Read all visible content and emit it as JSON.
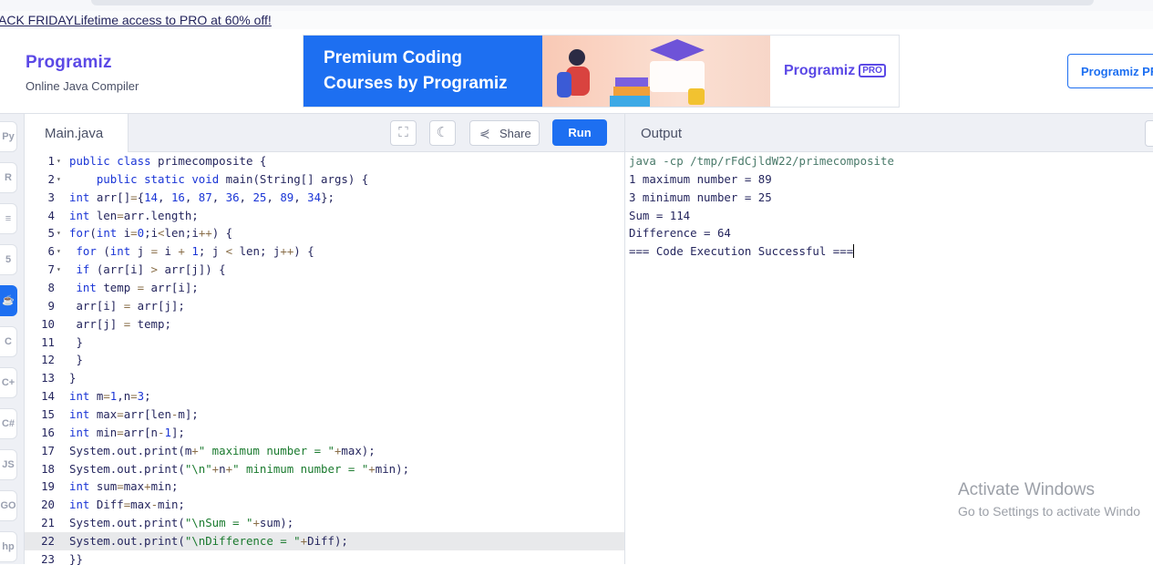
{
  "promo": {
    "text": "ACK FRIDAYLifetime access to PRO at 60% off!"
  },
  "header": {
    "logo": "Programiz",
    "subtitle": "Online Java Compiler",
    "banner": {
      "line1": "Premium Coding",
      "line2": "Courses by Programiz",
      "brand": "Programiz",
      "pro_badge": "PRO"
    },
    "cta_button": "Programiz PR"
  },
  "sidebar": {
    "items": [
      {
        "icon": "python-icon",
        "glyph": "Py"
      },
      {
        "icon": "r-icon",
        "glyph": "R"
      },
      {
        "icon": "sql-icon",
        "glyph": "≡"
      },
      {
        "icon": "html-icon",
        "glyph": "5"
      },
      {
        "icon": "java-icon",
        "glyph": "☕",
        "active": true
      },
      {
        "icon": "c-icon",
        "glyph": "C"
      },
      {
        "icon": "cpp-icon",
        "glyph": "C+"
      },
      {
        "icon": "csharp-icon",
        "glyph": "C#"
      },
      {
        "icon": "js-icon",
        "glyph": "JS"
      },
      {
        "icon": "go-icon",
        "glyph": "GO"
      },
      {
        "icon": "php-icon",
        "glyph": "hp"
      }
    ]
  },
  "editor": {
    "filename": "Main.java",
    "share_label": "Share",
    "run_label": "Run",
    "highlighted_line": 22,
    "lines": [
      "public class primecomposite {",
      "    public static void main(String[] args) {",
      "int arr[]={14, 16, 87, 36, 25, 89, 34};",
      "int len=arr.length;",
      "for(int i=0;i<len;i++) {",
      " for (int j = i + 1; j < len; j++) {",
      " if (arr[i] > arr[j]) {",
      " int temp = arr[i];",
      " arr[i] = arr[j];",
      " arr[j] = temp;",
      " }",
      " }",
      "}",
      "int m=1,n=3;",
      "int max=arr[len-m];",
      "int min=arr[n-1];",
      "System.out.print(m+\" maximum number = \"+max);",
      "System.out.print(\"\\n\"+n+\" minimum number = \"+min);",
      "int sum=max+min;",
      "int Diff=max-min;",
      "System.out.print(\"\\nSum = \"+sum);",
      "System.out.print(\"\\nDifference = \"+Diff);",
      "}}"
    ],
    "folds": [
      1,
      2,
      5,
      6,
      7
    ]
  },
  "output": {
    "title": "Output",
    "lines": [
      "java -cp /tmp/rFdCjldW22/primecomposite",
      "1 maximum number = 89",
      "3 minimum number = 25",
      "Sum = 114",
      "Difference = 64",
      "=== Code Execution Successful ==="
    ]
  },
  "watermark": {
    "title": "Activate Windows",
    "subtitle": "Go to Settings to activate Windo"
  }
}
